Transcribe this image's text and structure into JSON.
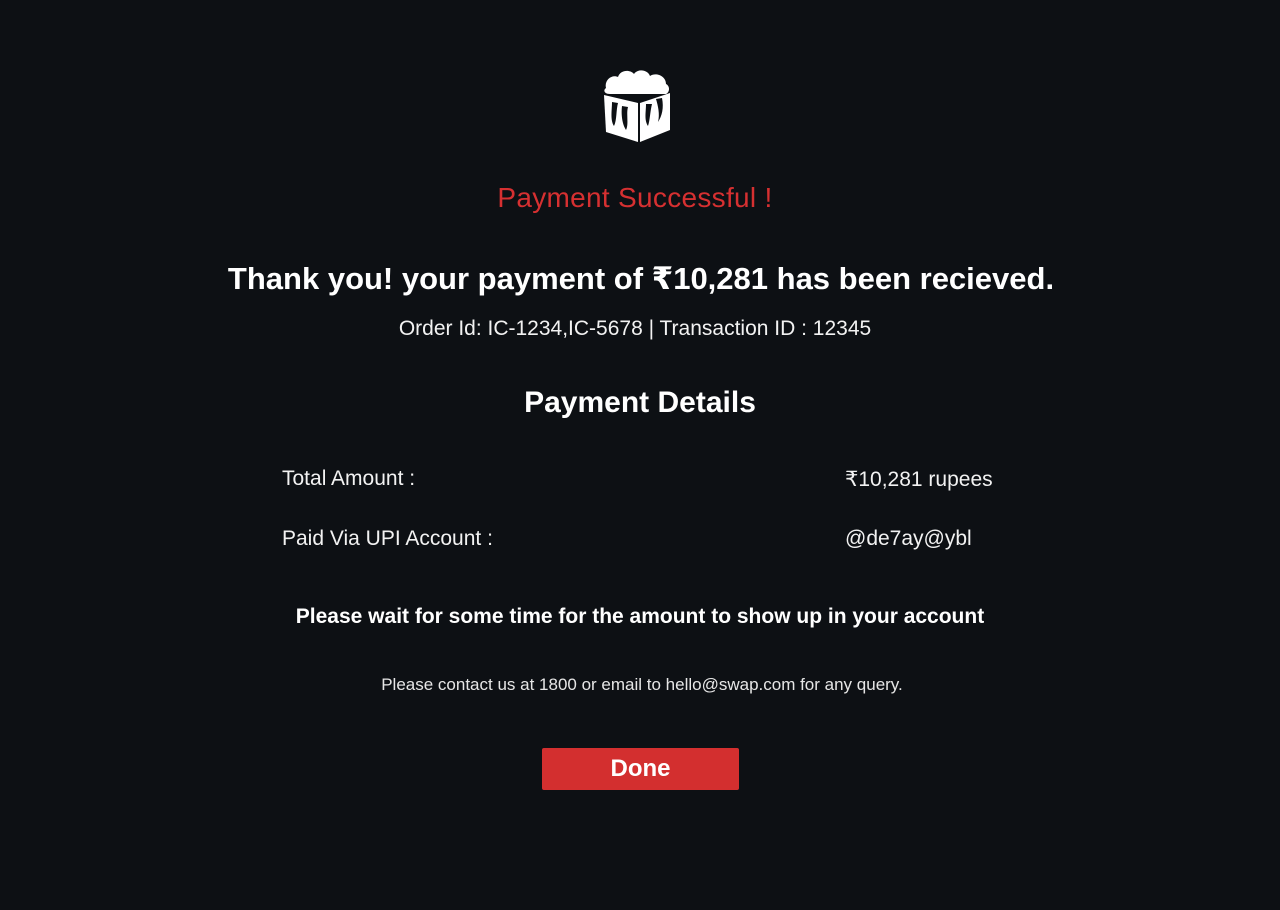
{
  "status": {
    "title": "Payment Successful !"
  },
  "receipt": {
    "headline": "Thank you! your payment of ₹10,281 has been recieved.",
    "order_line": "Order Id: IC-1234,IC-5678 | Transaction ID : 12345"
  },
  "details": {
    "title": "Payment Details",
    "rows": [
      {
        "label": "Total Amount :",
        "value": "₹10,281 rupees"
      },
      {
        "label": "Paid Via UPI Account :",
        "value": "@de7ay@ybl"
      }
    ]
  },
  "notes": {
    "wait": "Please wait for some time for the amount to show up in your account",
    "contact": "Please contact us at 1800 or email to hello@swap.com for any query."
  },
  "actions": {
    "done_label": "Done"
  },
  "icons": {
    "logo": "brand-logo-icon"
  },
  "colors": {
    "background": "#0d1014",
    "accent": "#d32f2f",
    "success_title": "#d63031",
    "text": "#ffffff"
  }
}
